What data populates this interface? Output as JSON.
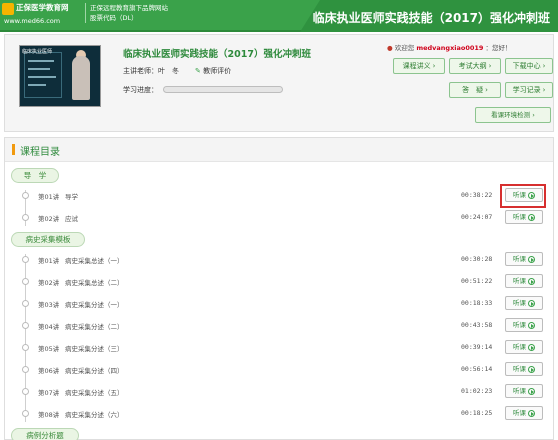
{
  "header": {
    "brand": "正保医学教育网",
    "url": "www.med66.com",
    "slogan_line1": "正保远程教育旗下品牌网站",
    "slogan_line2": "股票代码（DL）",
    "page_title": "临床执业医师实践技能（2017）强化冲刺班"
  },
  "course": {
    "title": "临床执业医师实践技能（2017）强化冲刺班",
    "teacher_label": "主讲老师：叶　冬",
    "rate_label": "教师评价",
    "progress_label": "学习进度：",
    "progress_value": 0,
    "thumb_caption": "临床执业医师"
  },
  "user": {
    "welcome_prefix": "欢迎您",
    "username": "medvangxiao0019",
    "welcome_suffix": "：您好！"
  },
  "buttons": {
    "lecture": "课程讲义",
    "syllabus": "考试大纲",
    "download": "下载中心",
    "qa": "答　疑",
    "record": "学习记录",
    "env_check": "看课环境检测"
  },
  "catalog": {
    "title": "课程目录",
    "listen_label": "听课",
    "sections": [
      {
        "name": "导　学",
        "lessons": [
          {
            "num": "第01讲",
            "name": "导学",
            "duration": "00:38:22"
          },
          {
            "num": "第02讲",
            "name": "应试",
            "duration": "00:24:07"
          }
        ]
      },
      {
        "name": "病史采集模板",
        "lessons": [
          {
            "num": "第01讲",
            "name": "病史采集总述（一）",
            "duration": "00:30:28"
          },
          {
            "num": "第02讲",
            "name": "病史采集总述（二）",
            "duration": "00:51:22"
          },
          {
            "num": "第03讲",
            "name": "病史采集分述（一）",
            "duration": "00:18:33"
          },
          {
            "num": "第04讲",
            "name": "病史采集分述（二）",
            "duration": "00:43:58"
          },
          {
            "num": "第05讲",
            "name": "病史采集分述（三）",
            "duration": "00:39:14"
          },
          {
            "num": "第06讲",
            "name": "病史采集分述（四）",
            "duration": "00:56:14"
          },
          {
            "num": "第07讲",
            "name": "病史采集分述（五）",
            "duration": "01:02:23"
          },
          {
            "num": "第08讲",
            "name": "病史采集分述（六）",
            "duration": "00:18:25"
          }
        ]
      },
      {
        "name": "病例分析题",
        "lessons": []
      }
    ]
  }
}
